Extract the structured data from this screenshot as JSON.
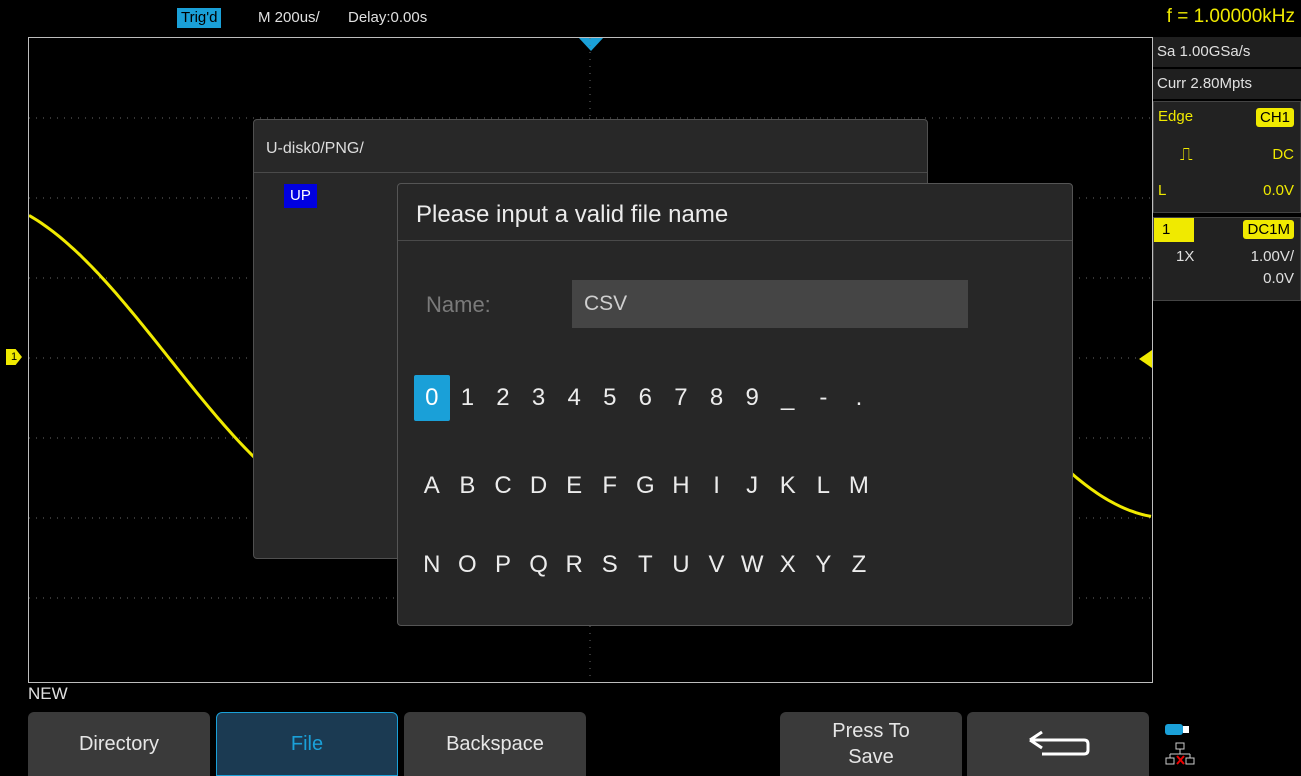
{
  "topbar": {
    "trig_status": "Trig'd",
    "timebase": "M 200us/",
    "delay": "Delay:0.00s",
    "frequency": "f = 1.00000kHz"
  },
  "info": {
    "sample_rate": "Sa 1.00GSa/s",
    "curr_depth": "Curr 2.80Mpts",
    "trigger": {
      "type": "Edge",
      "source": "CH1",
      "coupling": "DC",
      "level_label": "L",
      "level": "0.0V"
    },
    "channel": {
      "number": "1",
      "impedance": "DC1M",
      "probe": "1X",
      "scale": "1.00V/",
      "offset": "0.0V"
    }
  },
  "markers": {
    "channel": "1"
  },
  "directory_dialog": {
    "path": "U-disk0/PNG/",
    "up_item": "UP"
  },
  "keyboard_dialog": {
    "title": "Please input a valid file name",
    "name_label": "Name:",
    "name_value": "CSV",
    "rows": [
      [
        "0",
        "1",
        "2",
        "3",
        "4",
        "5",
        "6",
        "7",
        "8",
        "9",
        "_",
        "-",
        "."
      ],
      [
        "A",
        "B",
        "C",
        "D",
        "E",
        "F",
        "G",
        "H",
        "I",
        "J",
        "K",
        "L",
        "M"
      ],
      [
        "N",
        "O",
        "P",
        "Q",
        "R",
        "S",
        "T",
        "U",
        "V",
        "W",
        "X",
        "Y",
        "Z"
      ]
    ],
    "selected_key": "0"
  },
  "menu": {
    "title": "NEW",
    "softkeys": [
      "Directory",
      "File",
      "Backspace",
      "Press To Save"
    ],
    "active_softkey": "File"
  },
  "colors": {
    "channel1": "#f0ea00",
    "accent": "#1aa0d8"
  }
}
